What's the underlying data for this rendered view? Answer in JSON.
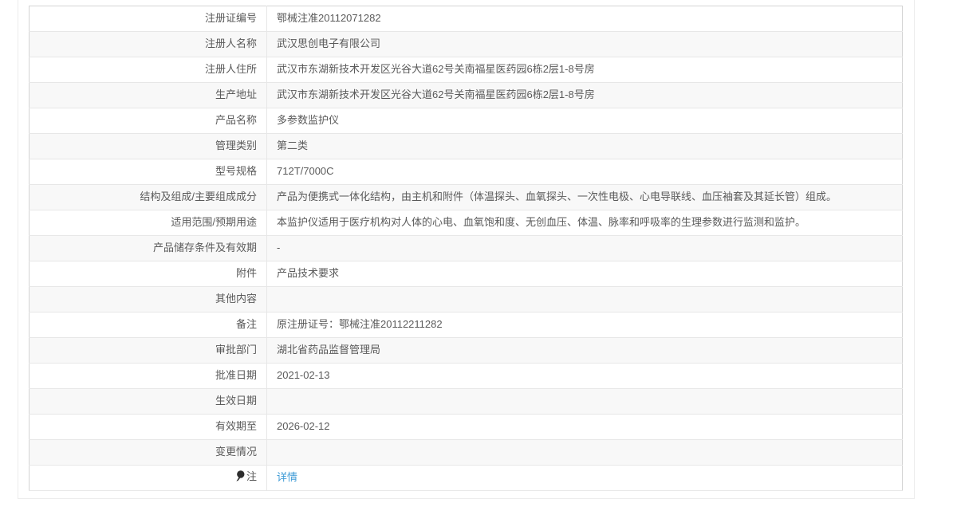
{
  "page": {
    "link_color": "#3e9bd6",
    "zebra_color": "#f8f8f8",
    "border_color": "#e7e7e7"
  },
  "table": {
    "rows": [
      {
        "label": "注册证编号",
        "value": "鄂械注准20112071282"
      },
      {
        "label": "注册人名称",
        "value": "武汉思创电子有限公司"
      },
      {
        "label": "注册人住所",
        "value": "武汉市东湖新技术开发区光谷大道62号关南福星医药园6栋2层1-8号房"
      },
      {
        "label": "生产地址",
        "value": "武汉市东湖新技术开发区光谷大道62号关南福星医药园6栋2层1-8号房"
      },
      {
        "label": "产品名称",
        "value": "多参数监护仪"
      },
      {
        "label": "管理类别",
        "value": "第二类"
      },
      {
        "label": "型号规格",
        "value": "712T/7000C"
      },
      {
        "label": "结构及组成/主要组成成分",
        "value": "产品为便携式一体化结构，由主机和附件（体温探头、血氧探头、一次性电极、心电导联线、血压袖套及其延长管）组成。"
      },
      {
        "label": "适用范围/预期用途",
        "value": "本监护仪适用于医疗机构对人体的心电、血氧饱和度、无创血压、体温、脉率和呼吸率的生理参数进行监测和监护。"
      },
      {
        "label": "产品储存条件及有效期",
        "value": "-"
      },
      {
        "label": "附件",
        "value": "产品技术要求"
      },
      {
        "label": "其他内容",
        "value": ""
      },
      {
        "label": "备注",
        "value": "原注册证号：鄂械注准20112211282"
      },
      {
        "label": "审批部门",
        "value": "湖北省药品监督管理局"
      },
      {
        "label": "批准日期",
        "value": "2021-02-13"
      },
      {
        "label": "生效日期",
        "value": ""
      },
      {
        "label": "有效期至",
        "value": "2026-02-12"
      },
      {
        "label": "变更情况",
        "value": ""
      },
      {
        "label": "注",
        "value": "详情",
        "icon": "pin-icon",
        "link": true
      }
    ]
  }
}
